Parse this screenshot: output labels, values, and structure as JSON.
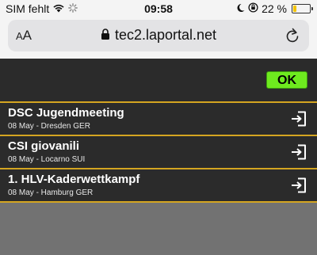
{
  "status_bar": {
    "carrier": "SIM fehlt",
    "time": "09:58",
    "battery_percent": "22 %",
    "battery_level": 0.22,
    "icons": [
      "wifi-icon",
      "loading-spinner-icon",
      "moon-icon",
      "orientation-lock-icon",
      "battery-icon"
    ]
  },
  "browser": {
    "aa_label_small": "A",
    "aa_label_large": "A",
    "url": "tec2.laportal.net",
    "icons": [
      "lock-icon",
      "reload-icon"
    ]
  },
  "toolbar": {
    "ok_label": "OK",
    "ok_color": "#6eea1f"
  },
  "colors": {
    "row_background": "#2b2b2b",
    "row_border": "#d4a521",
    "page_background": "#727272"
  },
  "events": [
    {
      "title": "DSC Jugendmeeting",
      "subtitle": "08 May - Dresden GER"
    },
    {
      "title": "CSI giovanili",
      "subtitle": "08 May - Locarno SUI"
    },
    {
      "title": "1. HLV-Kaderwettkampf",
      "subtitle": "08 May - Hamburg GER"
    }
  ]
}
